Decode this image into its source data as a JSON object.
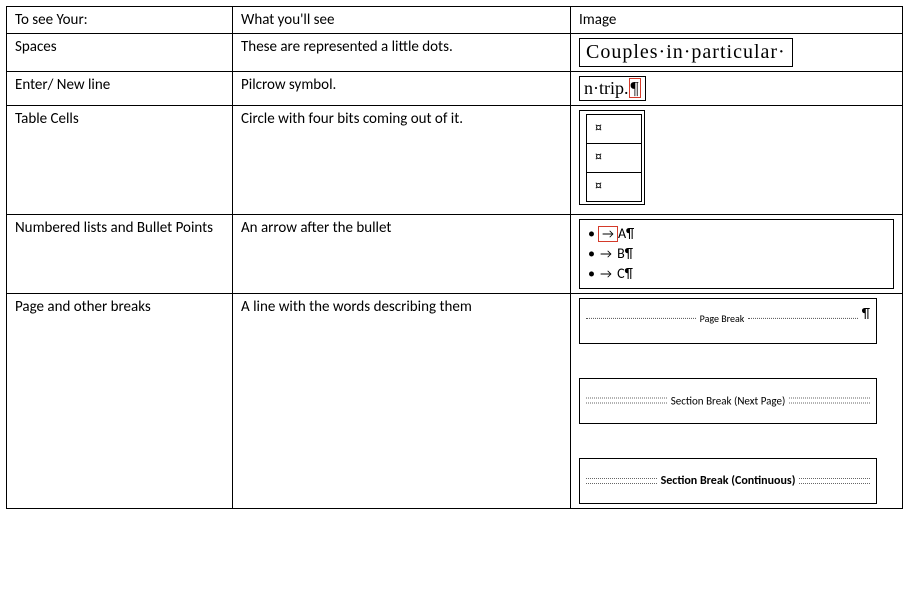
{
  "headers": {
    "col1": "To see Your:",
    "col2": "What you'll see",
    "col3": "Image"
  },
  "rows": {
    "spaces": {
      "name": "Spaces",
      "desc": "These are represented a little dots.",
      "sample": "Couples·in·particular·"
    },
    "enter": {
      "name": "Enter/ New line",
      "desc": "Pilcrow symbol.",
      "sample_prefix": "n·trip.",
      "sample_pilcrow": "¶"
    },
    "cells": {
      "name": "Table Cells",
      "desc": "Circle with four bits coming out of it.",
      "mark": "¤"
    },
    "lists": {
      "name": "Numbered lists and Bullet Points",
      "desc": "An arrow after the bullet",
      "items": {
        "a": "A¶",
        "b": "B¶",
        "c": "C¶"
      },
      "bullet": "•",
      "arrow": "→"
    },
    "breaks": {
      "name": "Page and other breaks",
      "desc": "A line with the words describing them",
      "page_break": "Page Break",
      "pilcrow": "¶",
      "section_next": "Section Break (Next Page)",
      "section_cont": "Section Break (Continuous)"
    }
  }
}
